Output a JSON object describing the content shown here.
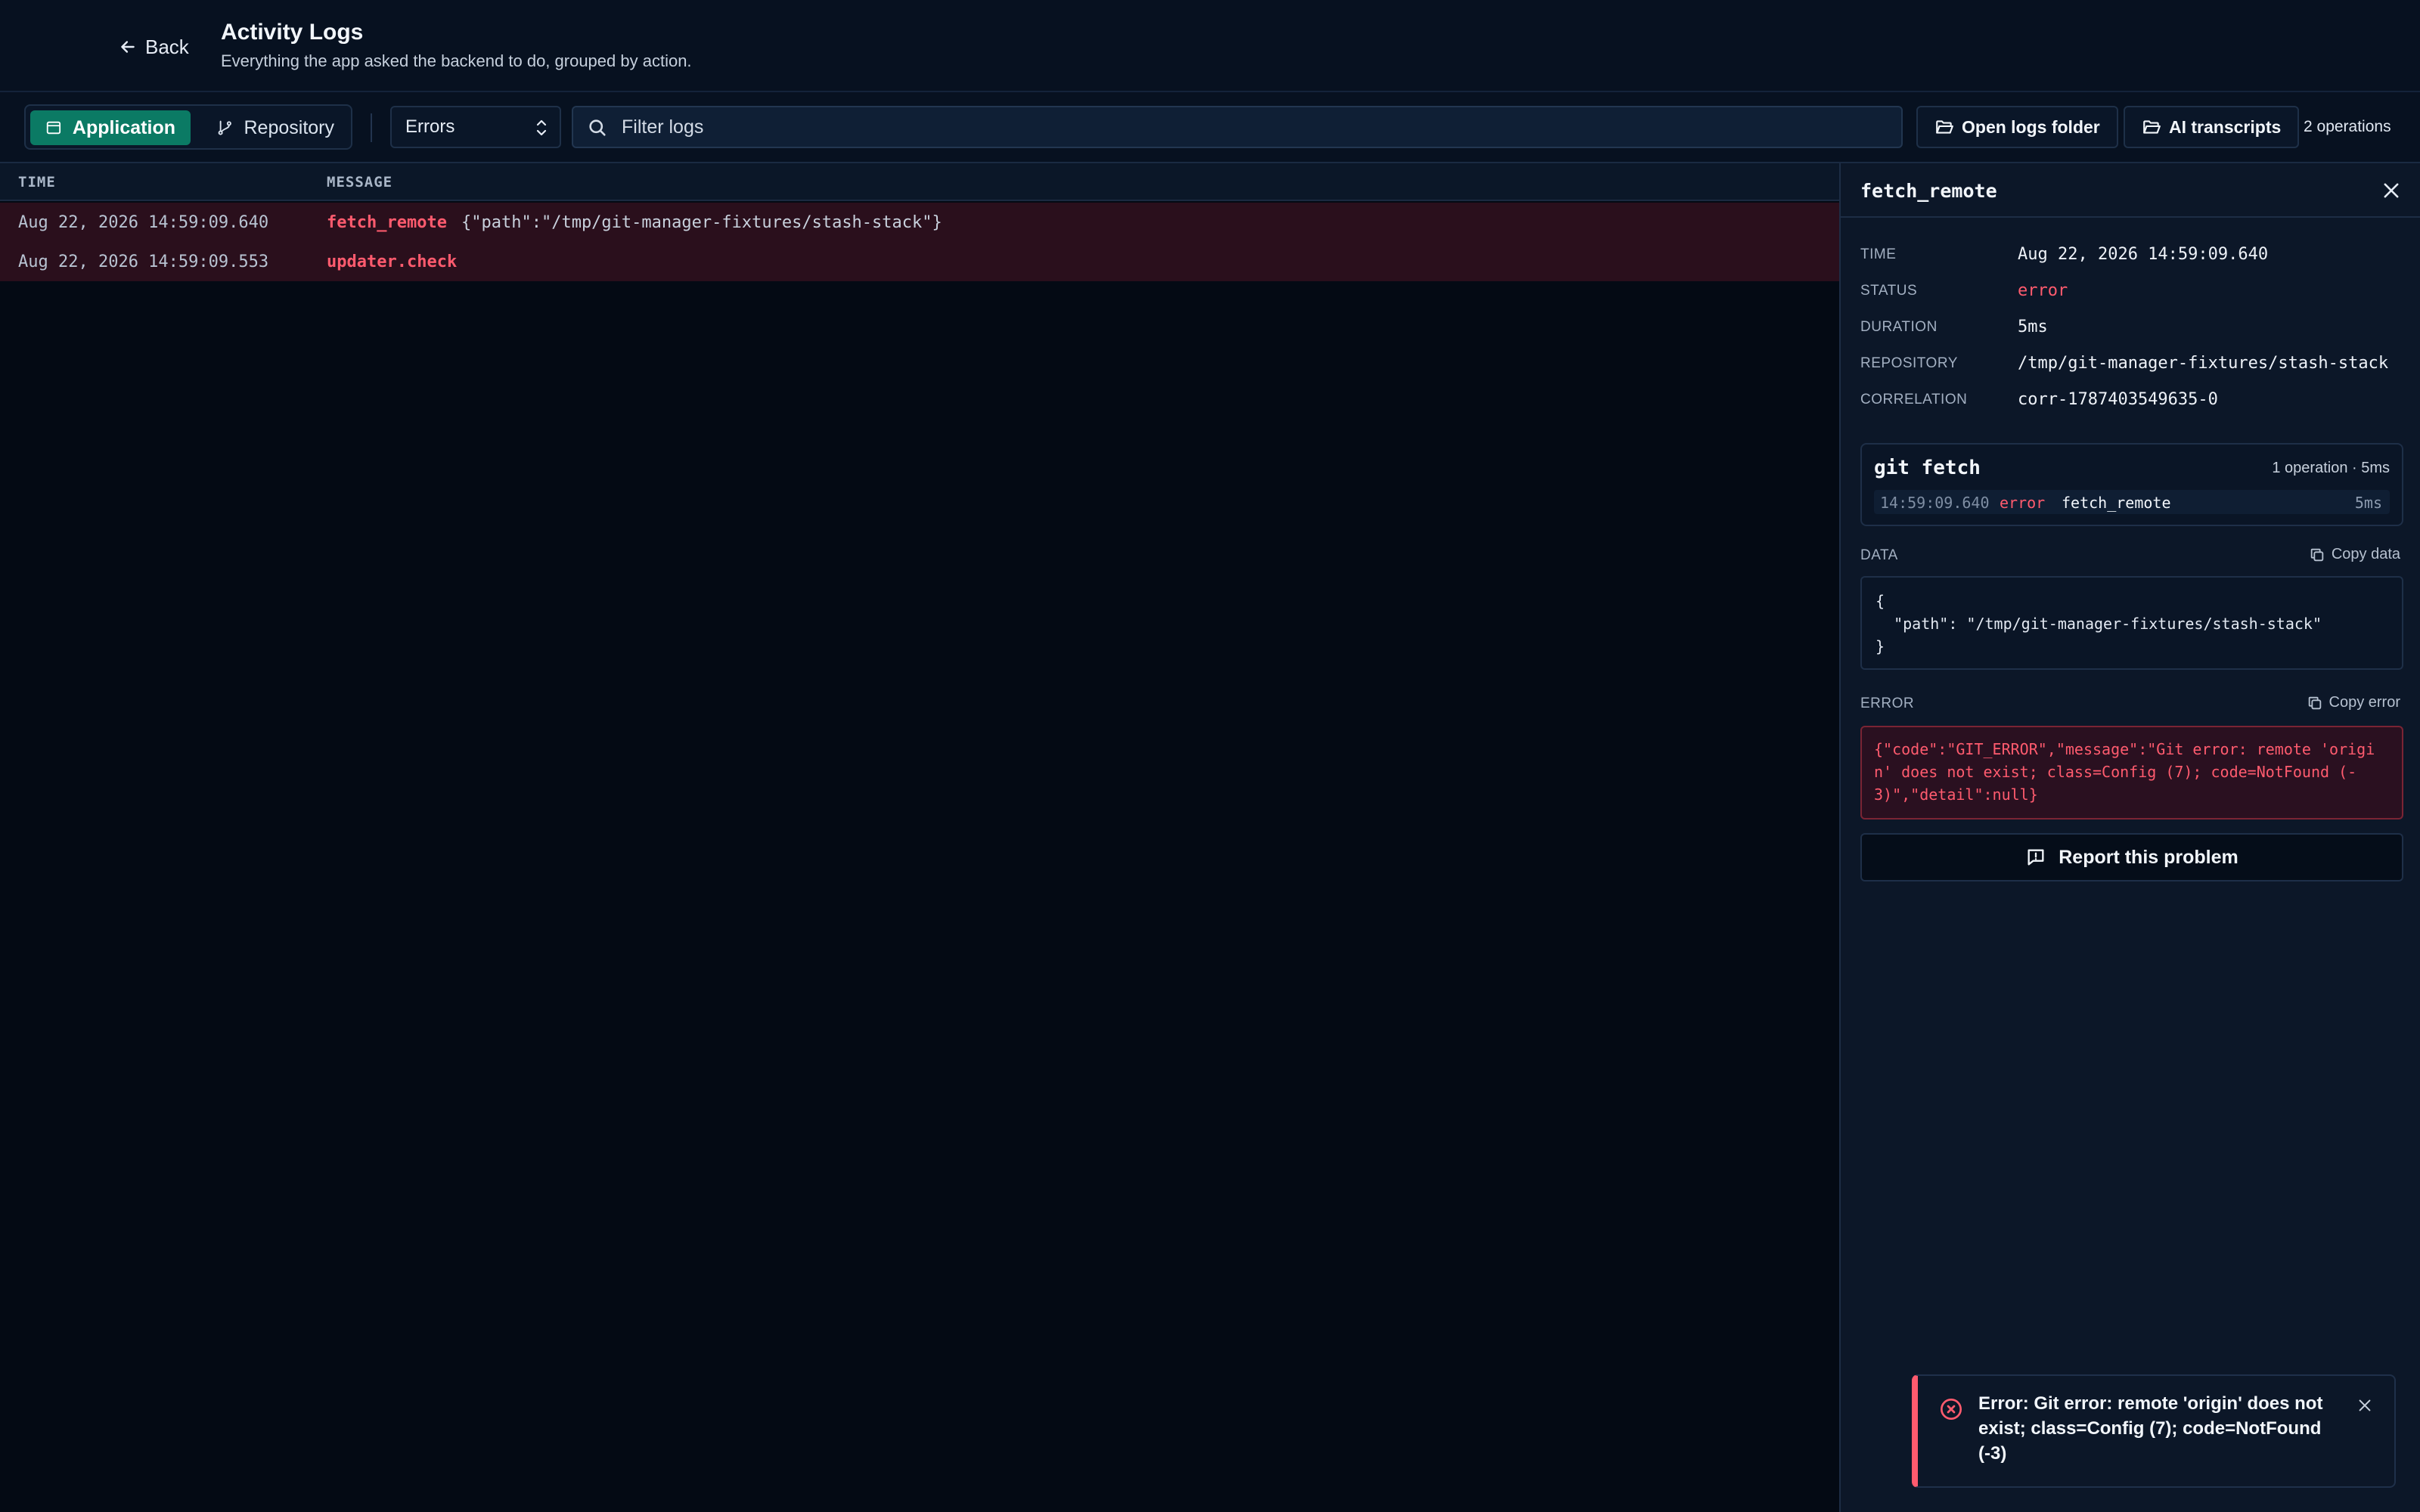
{
  "header": {
    "back_label": "Back",
    "title": "Activity Logs",
    "subtitle": "Everything the app asked the backend to do, grouped by action."
  },
  "toolbar": {
    "tabs": [
      {
        "label": "Application",
        "icon": "app-window-icon",
        "active": true
      },
      {
        "label": "Repository",
        "icon": "git-branch-icon",
        "active": false
      }
    ],
    "level_select": "Errors",
    "filter_placeholder": "Filter logs",
    "open_logs_label": "Open logs folder",
    "ai_transcripts_label": "AI transcripts",
    "operation_count": "2 operations"
  },
  "table": {
    "columns": [
      "TIME",
      "MESSAGE"
    ],
    "rows": [
      {
        "time": "Aug 22, 2026 14:59:09.640",
        "name": "fetch_remote",
        "data": "{\"path\":\"/tmp/git-manager-fixtures/stash-stack\"}"
      },
      {
        "time": "Aug 22, 2026 14:59:09.553",
        "name": "updater.check",
        "data": ""
      }
    ]
  },
  "detail": {
    "title": "fetch_remote",
    "fields": [
      {
        "key": "TIME",
        "value": "Aug 22, 2026 14:59:09.640"
      },
      {
        "key": "STATUS",
        "value": "error"
      },
      {
        "key": "DURATION",
        "value": "5ms"
      },
      {
        "key": "REPOSITORY",
        "value": "/tmp/git-manager-fixtures/stash-stack"
      },
      {
        "key": "CORRELATION",
        "value": "corr-1787403549635-0"
      }
    ],
    "group": {
      "title": "git fetch",
      "meta": "1 operation · 5ms",
      "entry_time": "14:59:09.640",
      "entry_status": "error",
      "entry_name": "fetch_remote",
      "entry_duration": "5ms"
    },
    "data_label": "DATA",
    "copy_data_label": "Copy data",
    "data_json": "{\n  \"path\": \"/tmp/git-manager-fixtures/stash-stack\"\n}",
    "error_label": "ERROR",
    "copy_error_label": "Copy error",
    "error_json": "{\"code\":\"GIT_ERROR\",\"message\":\"Git error: remote 'origin' does not exist; class=Config (7); code=NotFound (-3)\",\"detail\":null}",
    "report_label": "Report this problem"
  },
  "toast": {
    "message": "Error: Git error: remote 'origin' does not exist; class=Config (7); code=NotFound (-3)"
  },
  "colors": {
    "background": "#050b16",
    "accent": "#0b7a64",
    "error": "#ff5b6e",
    "panel": "#0c1728"
  }
}
